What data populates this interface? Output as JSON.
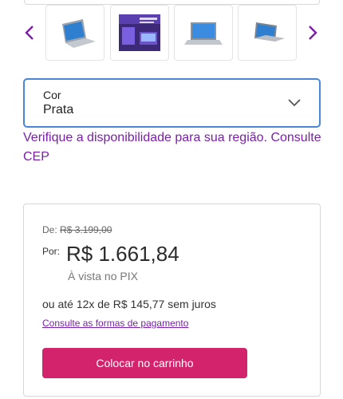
{
  "carousel": {
    "prev_icon": "chevron-left-icon",
    "next_icon": "chevron-right-icon",
    "arrow_color": "#7a1fa8",
    "thumbnails": [
      {
        "icon": "laptop-silver-icon"
      },
      {
        "icon": "promo-banner-icon"
      },
      {
        "icon": "laptop-open-icon"
      },
      {
        "icon": "laptop-angled-icon"
      }
    ]
  },
  "color_select": {
    "label": "Cor",
    "value": "Prata",
    "icon": "chevron-down-icon",
    "border_color": "#4a86d8"
  },
  "availability": {
    "text": "Verifique a disponibilidade para sua região. Consulte CEP",
    "color": "#7a1fa8"
  },
  "pricing": {
    "old_label": "De:",
    "old_price": "R$ 3.199,00",
    "por_label": "Por:",
    "current_price": "R$ 1.661,84",
    "pix_note": "À vista no PIX",
    "installments": "ou até 12x de R$ 145,77 sem juros",
    "payment_link": "Consulte as formas de pagamento",
    "cart_button": "Colocar no carrinho",
    "cart_button_color": "#d3236c"
  }
}
